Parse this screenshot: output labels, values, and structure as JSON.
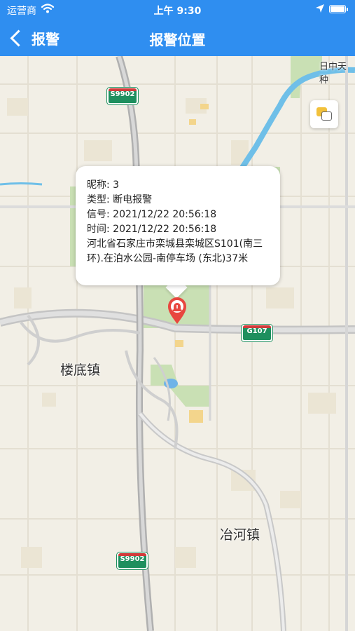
{
  "status_bar": {
    "carrier": "运营商",
    "time": "上午 9:30"
  },
  "nav": {
    "back_label": "报警",
    "title": "报警位置"
  },
  "map": {
    "road_shields": [
      "S9902",
      "G107",
      "S9902"
    ],
    "places": [
      "楼底镇",
      "冶河镇",
      "日中天种"
    ]
  },
  "popup": {
    "nickname_label": "昵称:",
    "nickname_value": "3",
    "type_label": "类型:",
    "type_value": "断电报警",
    "signal_label": "信号:",
    "signal_value": "2021/12/22 20:56:18",
    "time_label": "时间:",
    "time_value": "2021/12/22 20:56:18",
    "address": "河北省石家庄市栾城县栾城区S101(南三环).在泊水公园-南停车场 (东北)37米"
  },
  "colors": {
    "nav_bg": "#2f8ef0",
    "marker": "#e8473f",
    "shield": "#1e8f5e"
  },
  "icons": [
    "back-chevron-icon",
    "wifi-icon",
    "location-arrow-icon",
    "battery-icon",
    "map-layer-icon",
    "alarm-marker-icon"
  ]
}
